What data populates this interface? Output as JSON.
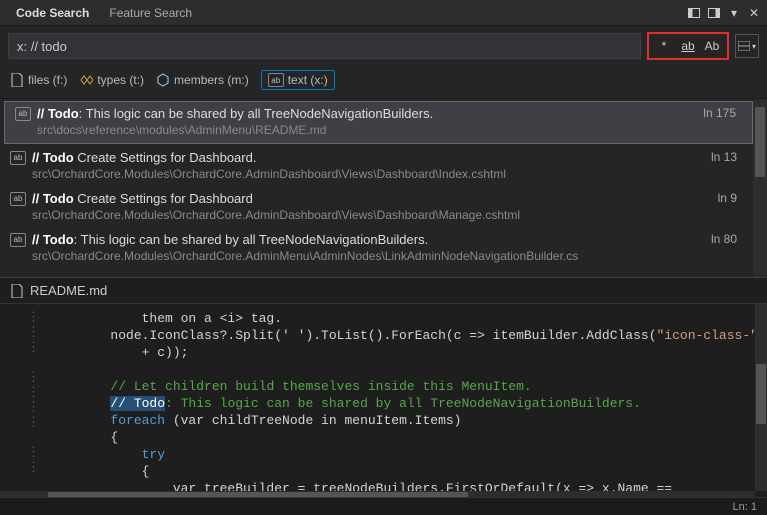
{
  "titlebar": {
    "tabs": [
      {
        "label": "Code Search",
        "active": true
      },
      {
        "label": "Feature Search",
        "active": false
      }
    ]
  },
  "search": {
    "query": "x: // todo",
    "options": {
      "wildcard": "*",
      "whole_word": "ab",
      "match_case": "Ab"
    }
  },
  "filters": [
    {
      "label": "files (f:)",
      "icon": "file-icon"
    },
    {
      "label": "types (t:)",
      "icon": "types-icon"
    },
    {
      "label": "members (m:)",
      "icon": "members-icon"
    },
    {
      "label": "text (x:)",
      "icon": "text-icon",
      "active": true
    }
  ],
  "results": [
    {
      "prefix_bold": "// Todo",
      "remainder": ": This logic can be shared by all TreeNodeNavigationBuilders.",
      "path": "src\\docs\\reference\\modules\\AdminMenu\\README.md",
      "line": "ln 175",
      "selected": true
    },
    {
      "prefix_bold": "// Todo",
      "remainder": " Create Settings for Dashboard.",
      "path": "src\\OrchardCore.Modules\\OrchardCore.AdminDashboard\\Views\\Dashboard\\Index.cshtml",
      "line": "ln 13",
      "selected": false
    },
    {
      "prefix_bold": "// Todo",
      "remainder": " Create Settings for Dashboard",
      "path": "src\\OrchardCore.Modules\\OrchardCore.AdminDashboard\\Views\\Dashboard\\Manage.cshtml",
      "line": "ln 9",
      "selected": false
    },
    {
      "prefix_bold": "// Todo",
      "remainder": ": This logic can be shared by all TreeNodeNavigationBuilders.",
      "path": "src\\OrchardCore.Modules\\OrchardCore.AdminMenu\\AdminNodes\\LinkAdminNodeNavigationBuilder.cs",
      "line": "ln 80",
      "selected": false
    }
  ],
  "preview": {
    "file_name": "README.md"
  },
  "code": {
    "lines": [
      {
        "indent": "            ",
        "content": "them on a <i> tag."
      },
      {
        "indent": "        ",
        "content": "node.IconClass?.Split(' ').ToList().ForEach(c => itemBuilder.AddClass(\"icon-class-\""
      },
      {
        "indent": "            ",
        "content": "+ c));"
      },
      {
        "indent": "",
        "content": ""
      },
      {
        "indent": "        ",
        "comment": "// Let children build themselves inside this MenuItem."
      },
      {
        "indent": "        ",
        "hl": "// Todo",
        "after_hl": ": This logic can be shared by all TreeNodeNavigationBuilders."
      },
      {
        "indent": "        ",
        "kw": "foreach",
        "content": " (var childTreeNode in menuItem.Items)"
      },
      {
        "indent": "        ",
        "content": "{"
      },
      {
        "indent": "            ",
        "kw": "try",
        "content": ""
      },
      {
        "indent": "            ",
        "content": "{"
      },
      {
        "indent": "                ",
        "content": "var treeBuilder = treeNodeBuilders.FirstOrDefault(x => x.Name =="
      }
    ]
  },
  "statusbar": {
    "position": "Ln: 1"
  }
}
